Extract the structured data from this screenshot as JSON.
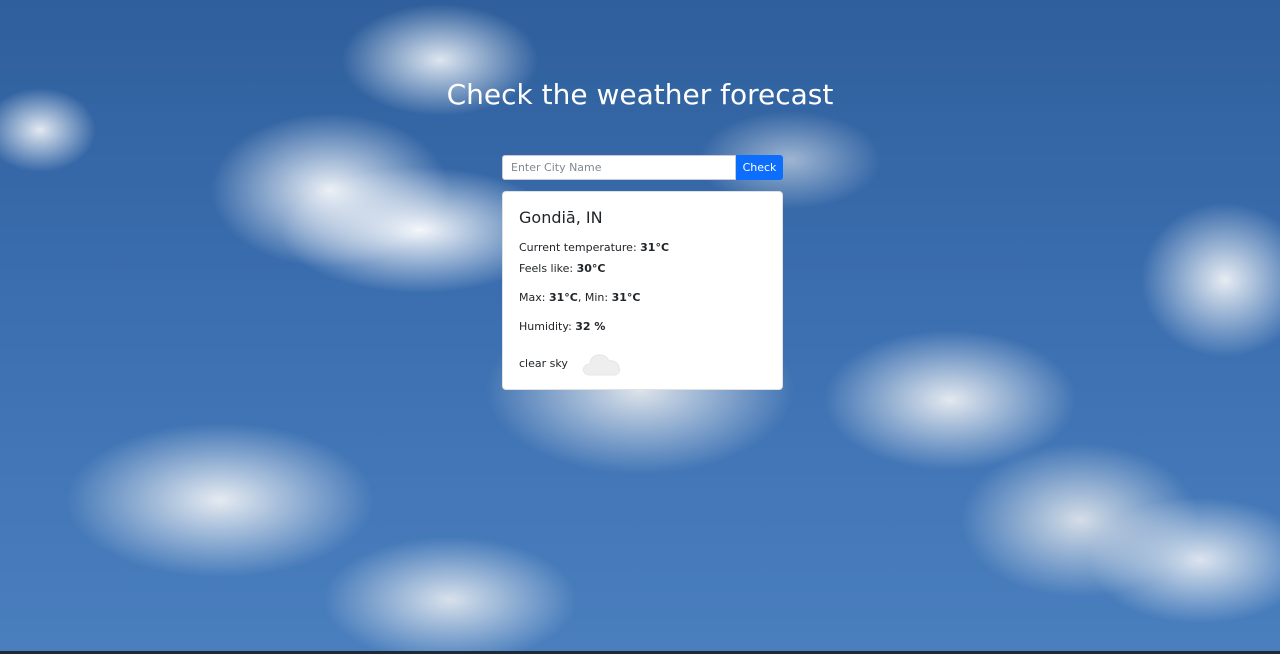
{
  "header": {
    "title": "Check the weather forecast"
  },
  "search": {
    "placeholder": "Enter City Name",
    "value": "",
    "button_label": "Check"
  },
  "weather": {
    "city": "Gondiā, IN",
    "current_label": "Current temperature: ",
    "current_value": "31°C",
    "feels_label": "Feels like: ",
    "feels_value": "30°C",
    "max_label": "Max: ",
    "max_value": "31°C",
    "min_label": ", Min: ",
    "min_value": "31°C",
    "humidity_label": "Humidity: ",
    "humidity_value": "32 %",
    "description": "clear sky",
    "icon": "cloud-icon"
  },
  "colors": {
    "button": "#0d6efd",
    "sky": "#3b6eaf",
    "card_bg": "#ffffff"
  }
}
